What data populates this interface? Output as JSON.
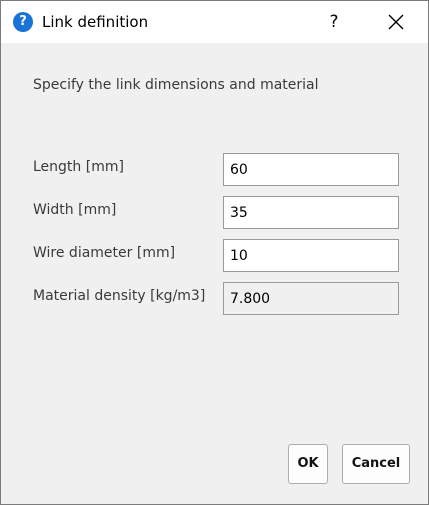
{
  "window": {
    "title": "Link definition",
    "title_icon": "question-mark-icon",
    "help_glyph": "?",
    "close_icon": "close-icon"
  },
  "instruction": "Specify the link dimensions and material",
  "fields": [
    {
      "label": "Length [mm]",
      "value": "60"
    },
    {
      "label": "Width  [mm]",
      "value": "35"
    },
    {
      "label": "Wire diameter [mm]",
      "value": "10"
    },
    {
      "label": "Material density [kg/m3]",
      "value": "7.800"
    }
  ],
  "buttons": {
    "ok_label": "OK",
    "cancel_label": "Cancel"
  },
  "colors": {
    "accent": "#1a73d6",
    "background": "#f0f0f0"
  }
}
